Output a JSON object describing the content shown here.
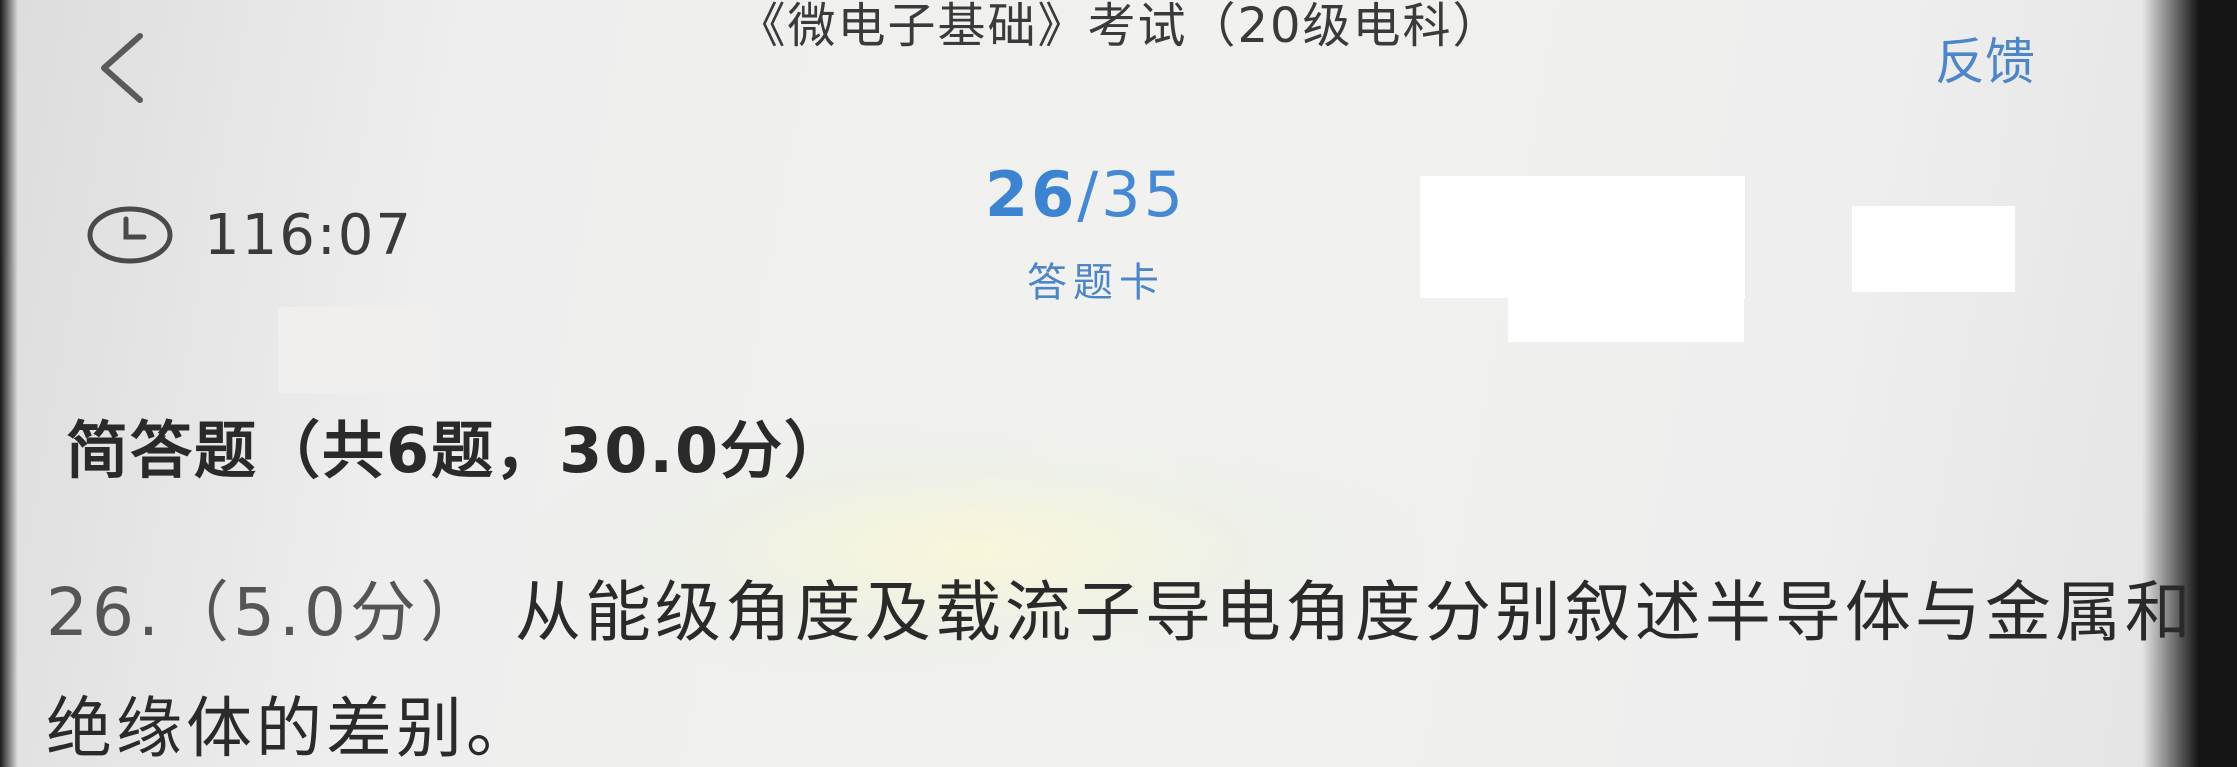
{
  "header": {
    "back_icon": "chevron-left-icon",
    "title": "《微电子基础》考试（20级电科）",
    "feedback_label": "反馈",
    "accent_color": "#3c83d2"
  },
  "status": {
    "clock_icon": "clock-icon",
    "timer": "116:07",
    "current_question": "26",
    "separator": "/",
    "total_questions": "35",
    "answer_card_label": "答题卡"
  },
  "section": {
    "heading": "简答题（共6题，30.0分）"
  },
  "question": {
    "number": "26.",
    "score": "（5.0分）",
    "text": "从能级角度及载流子导电角度分别叙述半导体与金属和绝缘体的差别。"
  }
}
